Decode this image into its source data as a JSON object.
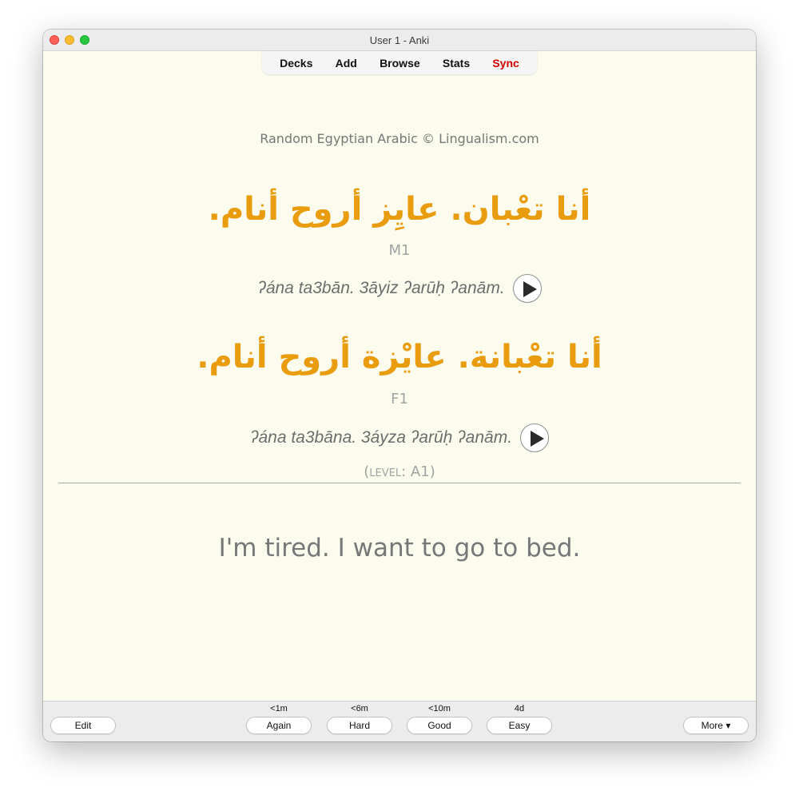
{
  "window": {
    "title": "User 1 - Anki"
  },
  "toolbar": {
    "decks": "Decks",
    "add": "Add",
    "browse": "Browse",
    "stats": "Stats",
    "sync": "Sync",
    "sync_color": "#d10000"
  },
  "card": {
    "source": "Random Egyptian Arabic © Lingualism.com",
    "m": {
      "arabic": "أنا تعْبان. عايِز أروح أنام.",
      "label": "M1",
      "translit": "ʔána ta3bān. 3āyiz ʔarūḥ ʔanām."
    },
    "f": {
      "arabic": "أنا تعْبانة. عايْزة أروح أنام.",
      "label": "F1",
      "translit": "ʔána ta3bāna. 3áyza ʔarūḥ ʔanām."
    },
    "level": {
      "open": "(",
      "word": "level",
      "sep": ":",
      "value": " A1",
      "close": ")"
    },
    "english": "I'm tired. I want to go to bed.",
    "arabic_color": "#e89c0e"
  },
  "bottom": {
    "edit": "Edit",
    "again": {
      "interval": "<1m",
      "label": "Again"
    },
    "hard": {
      "interval": "<6m",
      "label": "Hard"
    },
    "good": {
      "interval": "<10m",
      "label": "Good"
    },
    "easy": {
      "interval": "4d",
      "label": "Easy"
    },
    "more": "More ▾"
  }
}
